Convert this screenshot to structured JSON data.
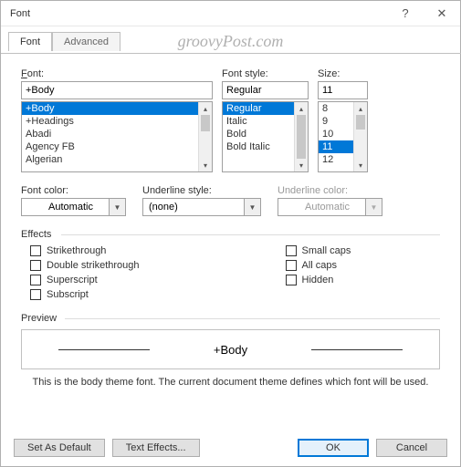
{
  "titlebar": {
    "title": "Font",
    "help": "?",
    "close": "✕"
  },
  "watermark": "groovyPost.com",
  "tabs": {
    "font": "Font",
    "advanced": "Advanced"
  },
  "labels": {
    "font": "Font:",
    "fontstyle": "Font style:",
    "size": "Size:",
    "fontcolor": "Font color:",
    "underlinestyle": "Underline style:",
    "underlinecolor": "Underline color:",
    "effects": "Effects",
    "preview": "Preview"
  },
  "font": {
    "value": "+Body",
    "items": [
      "+Body",
      "+Headings",
      "Abadi",
      "Agency FB",
      "Algerian"
    ],
    "selectedIndex": 0
  },
  "fontstyle": {
    "value": "Regular",
    "items": [
      "Regular",
      "Italic",
      "Bold",
      "Bold Italic"
    ],
    "selectedIndex": 0
  },
  "size": {
    "value": "11",
    "items": [
      "8",
      "9",
      "10",
      "11",
      "12"
    ],
    "selectedIndex": 3
  },
  "fontcolor": {
    "value": "Automatic"
  },
  "underlinestyle": {
    "value": "(none)"
  },
  "underlinecolor": {
    "value": "Automatic"
  },
  "effects": {
    "strike": "Strikethrough",
    "dstrike": "Double strikethrough",
    "super": "Superscript",
    "sub": "Subscript",
    "small": "Small caps",
    "all": "All caps",
    "hidden": "Hidden"
  },
  "preview": {
    "text": "+Body"
  },
  "note": "This is the body theme font. The current document theme defines which font will be used.",
  "buttons": {
    "setdefault": "Set As Default",
    "texteffects": "Text Effects...",
    "ok": "OK",
    "cancel": "Cancel"
  }
}
